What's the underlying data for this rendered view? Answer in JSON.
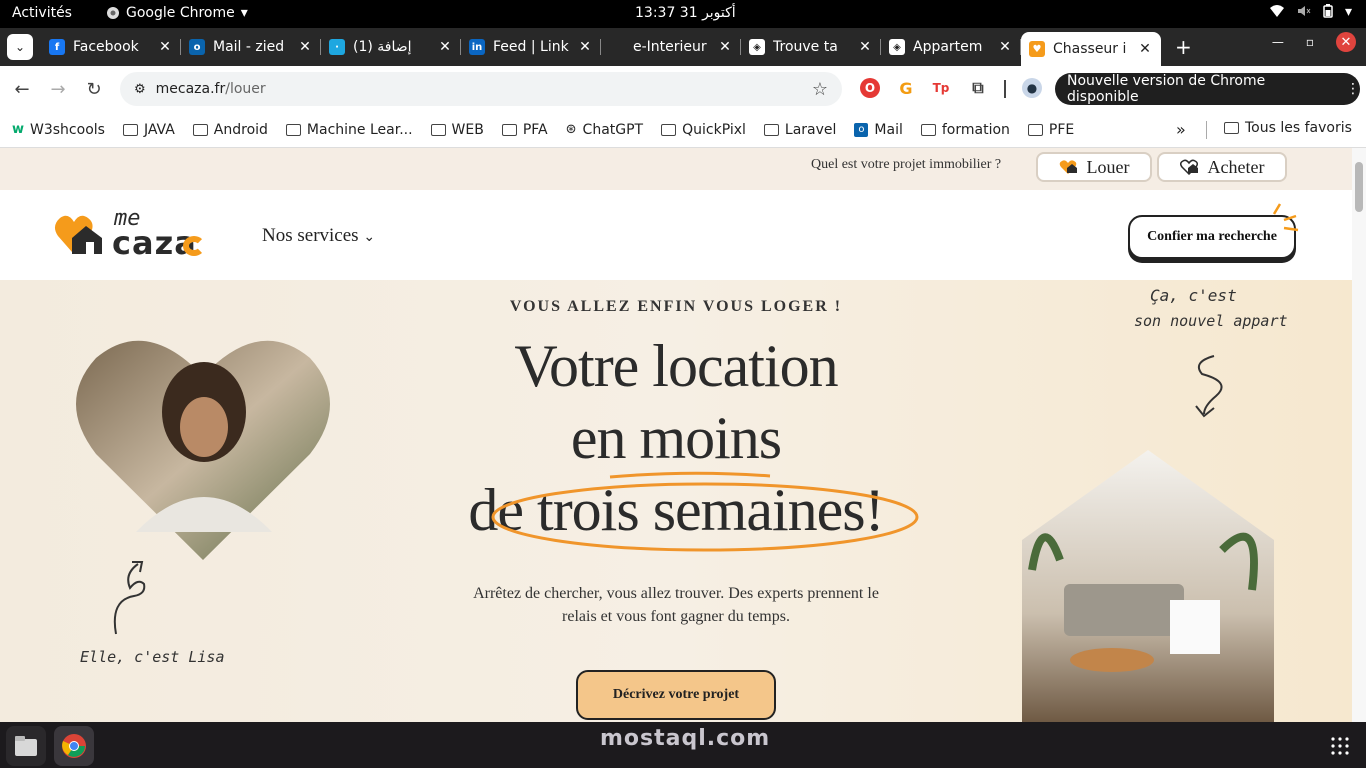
{
  "system": {
    "activities": "Activités",
    "app": "Google Chrome",
    "clock": "13:37  31 أكتوبر"
  },
  "tabs": [
    {
      "title": "Facebook",
      "fav_color": "#1877f2",
      "fav_glyph": "f"
    },
    {
      "title": "Mail - zied",
      "fav_color": "#0a64ad",
      "fav_glyph": "o"
    },
    {
      "title": "(1) إضافة",
      "fav_color": "#1ea7e0",
      "fav_glyph": "·"
    },
    {
      "title": "Feed | Link",
      "fav_color": "#0a66c2",
      "fav_glyph": "in"
    },
    {
      "title": "e-Interieur",
      "fav_color": "#282828",
      "fav_glyph": ""
    },
    {
      "title": "Trouve ta",
      "fav_color": "#ffffff",
      "fav_glyph": "◈"
    },
    {
      "title": "Appartem",
      "fav_color": "#ffffff",
      "fav_glyph": "◈"
    },
    {
      "title": "Chasseur i",
      "fav_color": "#f59b1b",
      "fav_glyph": "♥"
    }
  ],
  "omnibox": {
    "host": "mecaza.fr",
    "path": "/louer",
    "update_label": "Nouvelle version de Chrome disponible"
  },
  "bookmarks": [
    "W3shcools",
    "JAVA",
    "Android",
    "Machine Lear...",
    "WEB",
    "PFA",
    "ChatGPT",
    "QuickPixl",
    "Laravel",
    "Mail",
    "formation",
    "PFE"
  ],
  "bookmarks_more": "»",
  "bookmarks_all": "Tous les favoris",
  "site": {
    "question": "Quel est votre projet immobilier ?",
    "louer": "Louer",
    "acheter": "Acheter",
    "logo_me": "me",
    "logo_caza": "caza",
    "services": "Nos services",
    "confier": "Confier ma recherche",
    "kicker": "VOUS ALLEZ ENFIN VOUS LOGER !",
    "title_1": "Votre location",
    "title_2": "en moins",
    "title_3": "de trois semaines!",
    "lead": "Arrêtez de chercher, vous allez trouver.  Des experts prennent le relais et vous font gagner du temps.",
    "cta": "Décrivez votre projet",
    "note_left": "Elle, c'est Lisa",
    "note_right_1": "Ça, c'est",
    "note_right_2": "son nouvel appart"
  },
  "watermark": "mostaql.com",
  "colors": {
    "brand_orange": "#f59b1b",
    "brand_dark": "#2b2b2b",
    "cta_bg": "#f4c68a"
  }
}
